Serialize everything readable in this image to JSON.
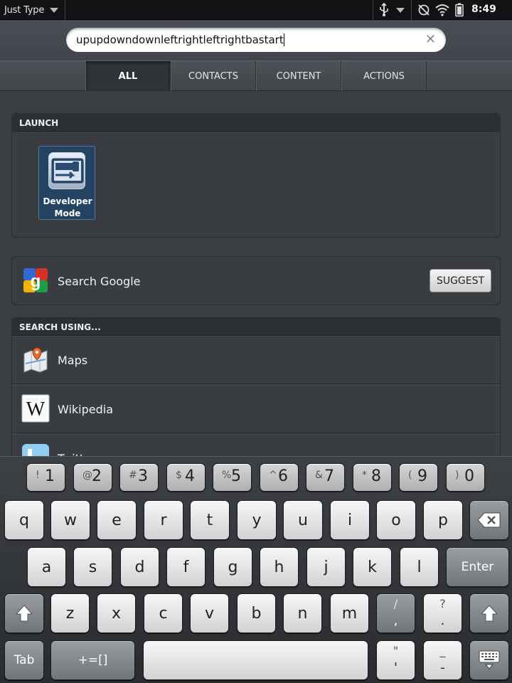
{
  "status_bar": {
    "app_menu_label": "Just Type",
    "time": "8:49"
  },
  "search": {
    "query": "upupdowndownleftrightleftrightbastart"
  },
  "tabs": [
    {
      "label": "ALL",
      "active": true
    },
    {
      "label": "CONTACTS",
      "active": false
    },
    {
      "label": "CONTENT",
      "active": false
    },
    {
      "label": "ACTIONS",
      "active": false
    }
  ],
  "launch": {
    "header": "LAUNCH",
    "app_label_line1": "Developer",
    "app_label_line2": "Mode"
  },
  "google": {
    "label": "Search Google",
    "suggest_label": "SUGGEST"
  },
  "search_using": {
    "header": "SEARCH USING...",
    "items": [
      {
        "label": "Maps",
        "icon": "maps-icon"
      },
      {
        "label": "Wikipedia",
        "icon": "wikipedia-icon"
      },
      {
        "label": "Twitter",
        "icon": "twitter-icon"
      }
    ]
  },
  "keyboard": {
    "number_row": [
      {
        "sym": "!",
        "num": "1"
      },
      {
        "sym": "@",
        "num": "2"
      },
      {
        "sym": "#",
        "num": "3"
      },
      {
        "sym": "$",
        "num": "4"
      },
      {
        "sym": "%",
        "num": "5"
      },
      {
        "sym": "^",
        "num": "6"
      },
      {
        "sym": "&",
        "num": "7"
      },
      {
        "sym": "*",
        "num": "8"
      },
      {
        "sym": "(",
        "num": "9"
      },
      {
        "sym": ")",
        "num": "0"
      }
    ],
    "row1": [
      "q",
      "w",
      "e",
      "r",
      "t",
      "y",
      "u",
      "i",
      "o",
      "p"
    ],
    "row2": [
      "a",
      "s",
      "d",
      "f",
      "g",
      "h",
      "j",
      "k",
      "l"
    ],
    "row3": [
      "z",
      "x",
      "c",
      "v",
      "b",
      "n",
      "m"
    ],
    "slash_top": "/",
    "slash_bottom": ",",
    "question_top": "?",
    "question_bottom": ".",
    "quote_top": "\"",
    "quote_bottom": "'",
    "underscore_top": "_",
    "underscore_bottom": "-",
    "enter_label": "Enter",
    "tab_label": "Tab",
    "symbols_label": "+=[]"
  },
  "colors": {
    "background": "#3a3e43",
    "app_tile": "#244361"
  }
}
